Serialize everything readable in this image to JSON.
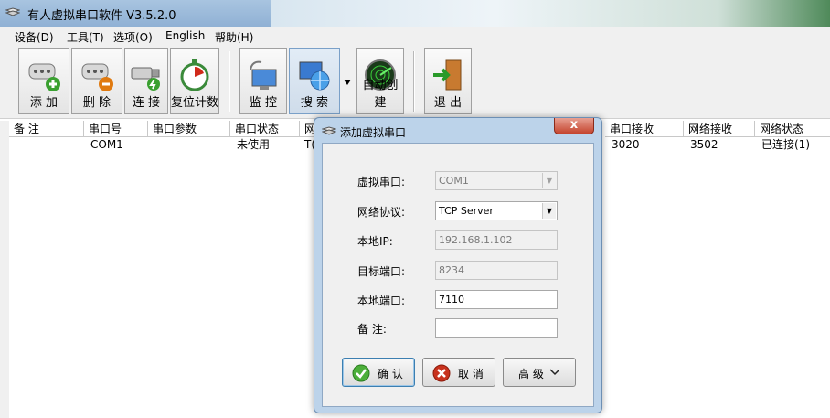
{
  "window": {
    "title": "有人虚拟串口软件 V3.5.2.0"
  },
  "menu": [
    "设备(D)",
    "工具(T)",
    "选项(O)",
    "English",
    "帮助(H)"
  ],
  "toolbar": {
    "add": "添 加",
    "delete": "删 除",
    "connect": "连 接",
    "reset_count": "复位计数",
    "monitor": "监 控",
    "search": "搜 索",
    "auto_create": "自动创建",
    "exit": "退 出"
  },
  "table": {
    "columns": [
      "备 注",
      "串口号",
      "串口参数",
      "串口状态",
      "网",
      "串口接收",
      "网络接收",
      "网络状态"
    ],
    "rows": [
      {
        "note": "",
        "port": "COM1",
        "params": "",
        "port_status": "未使用",
        "net_trunc": "T(",
        "port_recv": "3020",
        "net_recv": "3502",
        "net_status": "已连接(1)"
      }
    ]
  },
  "dialog": {
    "title": "添加虚拟串口",
    "close_label": "x",
    "fields": {
      "virtual_port_label": "虚拟串口:",
      "virtual_port_value": "COM1",
      "protocol_label": "网络协议:",
      "protocol_value": "TCP Server",
      "local_ip_label": "本地IP:",
      "local_ip_value": "192.168.1.102",
      "target_port_label": "目标端口:",
      "target_port_value": "8234",
      "local_port_label": "本地端口:",
      "local_port_value": "7110",
      "note_label": "备 注:",
      "note_value": ""
    },
    "buttons": {
      "ok": "确 认",
      "cancel": "取 消",
      "advanced": "高 级"
    }
  },
  "colors": {
    "ok_green": "#4caf3a",
    "cancel_red": "#c8321e"
  }
}
